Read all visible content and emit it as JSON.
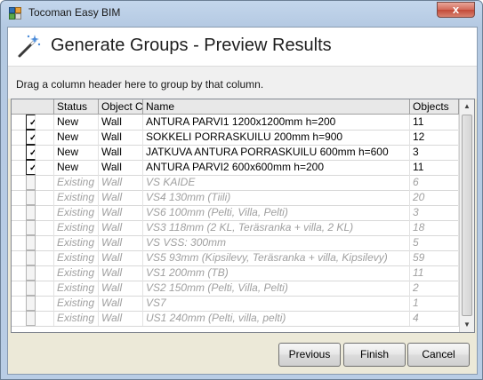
{
  "window": {
    "title": "Tocoman Easy BIM",
    "close_label": "x"
  },
  "header": {
    "title": "Generate Groups - Preview Results"
  },
  "group_bar": {
    "text": "Drag a column header here to group by that column."
  },
  "grid": {
    "columns": [
      "",
      "Status",
      "Object C",
      "Name",
      "Objects"
    ],
    "rows": [
      {
        "checked": true,
        "enabled": true,
        "status": "New",
        "object_class": "Wall",
        "name": "ANTURA PARVI1 1200x1200mm h=200",
        "objects": "11"
      },
      {
        "checked": true,
        "enabled": true,
        "status": "New",
        "object_class": "Wall",
        "name": "SOKKELI PORRASKUILU 200mm  h=900",
        "objects": "12"
      },
      {
        "checked": true,
        "enabled": true,
        "status": "New",
        "object_class": "Wall",
        "name": "JATKUVA ANTURA PORRASKUILU 600mm  h=600",
        "objects": "3"
      },
      {
        "checked": true,
        "enabled": true,
        "status": "New",
        "object_class": "Wall",
        "name": "ANTURA PARVI2 600x600mm h=200",
        "objects": "11"
      },
      {
        "checked": false,
        "enabled": false,
        "status": "Existing",
        "object_class": "Wall",
        "name": "VS KAIDE",
        "objects": "6"
      },
      {
        "checked": false,
        "enabled": false,
        "status": "Existing",
        "object_class": "Wall",
        "name": "VS4 130mm (Tiili)",
        "objects": "20"
      },
      {
        "checked": false,
        "enabled": false,
        "status": "Existing",
        "object_class": "Wall",
        "name": "VS6 100mm (Pelti, Villa, Pelti)",
        "objects": "3"
      },
      {
        "checked": false,
        "enabled": false,
        "status": "Existing",
        "object_class": "Wall",
        "name": "VS3 118mm (2 KL, Teräsranka + villa, 2 KL)",
        "objects": "18"
      },
      {
        "checked": false,
        "enabled": false,
        "status": "Existing",
        "object_class": "Wall",
        "name": "VS VSS: 300mm",
        "objects": "5"
      },
      {
        "checked": false,
        "enabled": false,
        "status": "Existing",
        "object_class": "Wall",
        "name": "VS5 93mm (Kipsilevy, Teräsranka + villa, Kipsilevy)",
        "objects": "59"
      },
      {
        "checked": false,
        "enabled": false,
        "status": "Existing",
        "object_class": "Wall",
        "name": "VS1 200mm (TB)",
        "objects": "11"
      },
      {
        "checked": false,
        "enabled": false,
        "status": "Existing",
        "object_class": "Wall",
        "name": "VS2 150mm (Pelti, Villa, Pelti)",
        "objects": "2"
      },
      {
        "checked": false,
        "enabled": false,
        "status": "Existing",
        "object_class": "Wall",
        "name": "VS7",
        "objects": "1"
      },
      {
        "checked": false,
        "enabled": false,
        "status": "Existing",
        "object_class": "Wall",
        "name": "US1 240mm (Pelti, villa, pelti)",
        "objects": "4"
      }
    ]
  },
  "buttons": {
    "previous": "Previous",
    "finish": "Finish",
    "cancel": "Cancel"
  },
  "colors": {
    "title_bar": "#b9cde5",
    "close_button": "#c24a38",
    "disabled_text": "#a0a0a0",
    "dialog_bg": "#ece9d8"
  }
}
